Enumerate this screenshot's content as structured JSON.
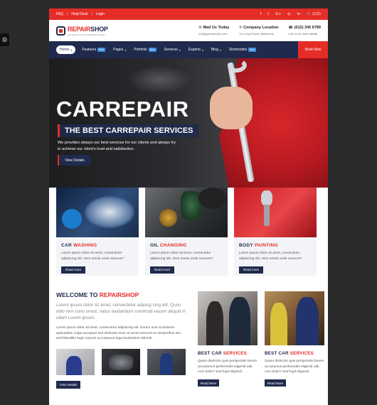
{
  "side_tab": {
    "icon": "settings-icon",
    "glyph": "⚙"
  },
  "topbar": {
    "links": [
      "FAQ",
      "Help Desk",
      "Login"
    ],
    "social": [
      {
        "icon": "facebook-icon",
        "glyph": "f"
      },
      {
        "icon": "twitter-icon",
        "glyph": "t"
      },
      {
        "icon": "google-plus-icon",
        "glyph": "G+"
      },
      {
        "icon": "instagram-icon",
        "glyph": "◎"
      },
      {
        "icon": "linkedin-icon",
        "glyph": "in"
      }
    ],
    "cart": "(1/2)",
    "cart_glyph": "🛒"
  },
  "header": {
    "logo_repair": "REPAIR",
    "logo_shop": "SHOP",
    "logo_tagline": "Car Repair & Servicing WWW Template",
    "mail_title": "Mail Us Today",
    "mail_value": "info@yourdomain.com",
    "location_title": "Company Location",
    "location_value": "121 King Street, Melbourne",
    "phone_title": "(012) 345 6789",
    "phone_value": "Call us for more details"
  },
  "nav": {
    "items": [
      {
        "label": "Home",
        "caret": "▾",
        "active": true
      },
      {
        "label": "Features",
        "badge": "New"
      },
      {
        "label": "Pages",
        "caret": "▾"
      },
      {
        "label": "Portfolio",
        "badge": "New"
      },
      {
        "label": "Services",
        "caret": "▾"
      },
      {
        "label": "Experts",
        "caret": "▾"
      },
      {
        "label": "Blog",
        "caret": "▾"
      },
      {
        "label": "Shortcodes",
        "badge": "New"
      }
    ],
    "book": "Book Now"
  },
  "hero": {
    "title": "CARREPAIR",
    "subtitle": "THE BEST CARREPAIR SERVICES",
    "text": "We provides always our best services for our clients and always try to achieve our client's trust and satisfaction.",
    "button": "View Details"
  },
  "services": [
    {
      "title_a": "CAR ",
      "title_b": "WASHING",
      "text": "Lorem ipsum dolor sit amet, consectetur adipiscing elit. Vero omnis unde nescunt?",
      "button": "Read more"
    },
    {
      "title_a": "OIL ",
      "title_b": "CHANGING",
      "text": "Lorem ipsum dolor sit amet, consectetur adipiscing elit. Vero omnis unde nescunt?",
      "button": "Read more"
    },
    {
      "title_a": "BODY ",
      "title_b": "PAINTING",
      "text": "Lorem ipsum dolor sit amet, consectetur adipiscing elit. Vero omnis unde nescunt?",
      "button": "Read more"
    }
  ],
  "welcome": {
    "title_a": "WELCOME TO ",
    "title_b": "REPAIRSHOP",
    "lead": "Lorem ipsum dolor sit amet, consectetur adipisg cing elit. Quos dolo rem cono unvut, natus laudantium commodi earum aliquid in ullam Lorem ipsum.",
    "body": "Lorem ipsum dolor sit amet, consectetur adipiscing elit. Earum sunt at dolorem quibusdam culpa excepturi sed distinctio eius! Ut amet nesciunt ex temporibus iste sed blanditiis fugit corporis accusamus fuga laudantium deleniti.",
    "button": "View Details"
  },
  "blocks": [
    {
      "title_a": "BEST CAR ",
      "title_b": "SERVICES",
      "text": "Quam distinctio quis perspiciatis facere accusamus perferendis eligendi odit cum dolor? Sed fugit eligendi.",
      "button": "Read More"
    },
    {
      "title_a": "BEST CAR ",
      "title_b": "SERVICES",
      "text": "Quam distinctio quis perspiciatis facere accusamus perferendis eligendi odit cum dolor? Sed fugit eligendi.",
      "button": "Read More"
    }
  ]
}
